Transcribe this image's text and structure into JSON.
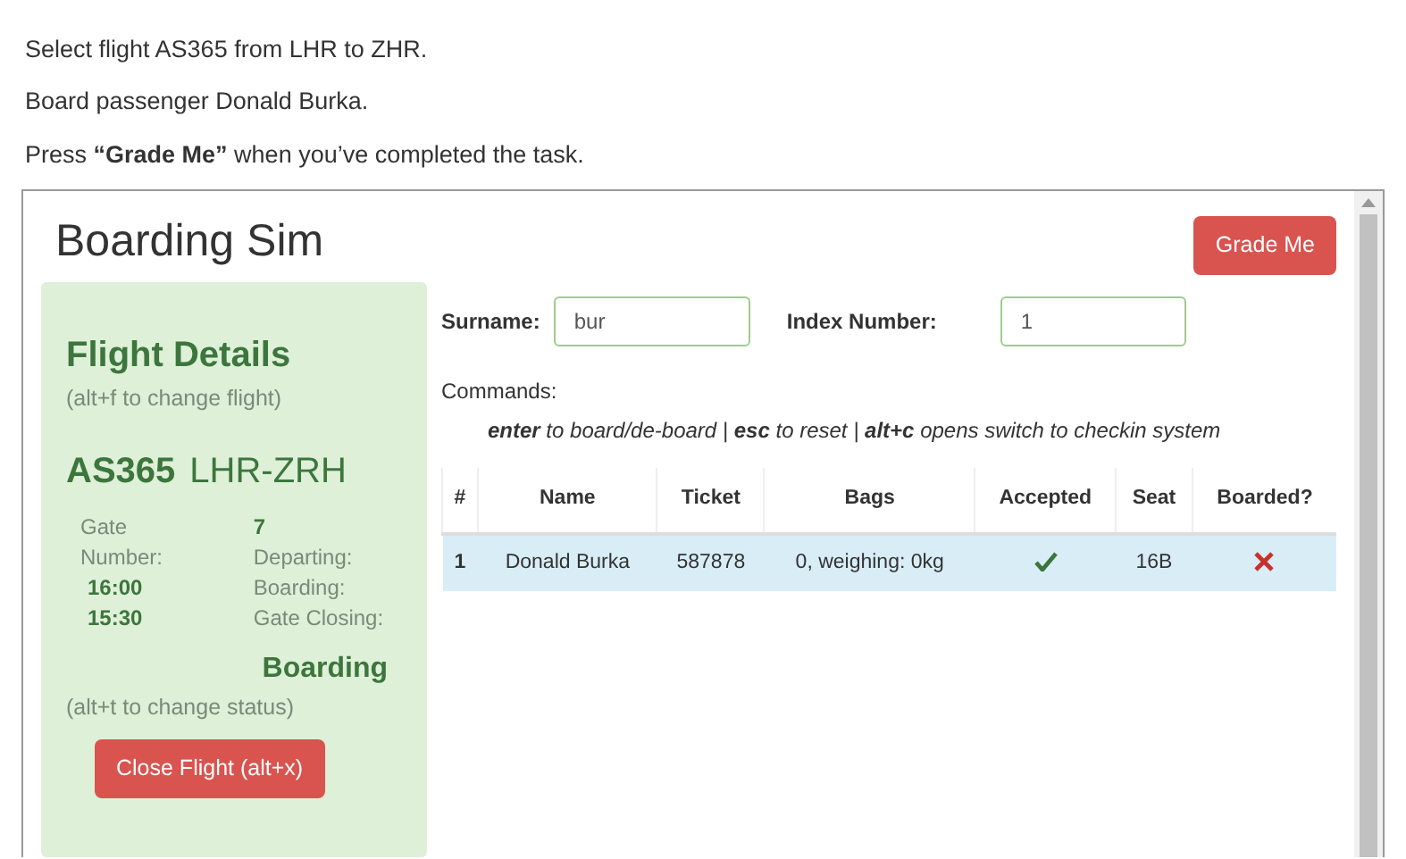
{
  "instructions": [
    "Select flight AS365 from LHR to ZHR.",
    "Board passenger Donald Burka.",
    "Press **“Grade Me”** when you’ve completed the task."
  ],
  "app": {
    "title": "Boarding Sim",
    "grade_button": "Grade Me"
  },
  "flight": {
    "heading": "Flight Details",
    "hint": "(alt+f to change flight)",
    "code": "AS365",
    "route": "LHR-ZRH",
    "left": [
      {
        "text": "Gate Number:",
        "kind": "label"
      },
      {
        "text": "16:00",
        "kind": "value"
      },
      {
        "text": "15:30",
        "kind": "value"
      }
    ],
    "right": [
      {
        "text": "7",
        "kind": "value"
      },
      {
        "text": "Departing:",
        "kind": "label"
      },
      {
        "text": "Boarding:",
        "kind": "label"
      },
      {
        "text": "Gate Closing:",
        "kind": "label"
      }
    ],
    "status": "Boarding",
    "status_hint": "(alt+t to change status)",
    "close_button": "Close Flight (alt+x)"
  },
  "search": {
    "surname_label": "Surname:",
    "surname": "bur",
    "index_label": "Index Number:",
    "index": "1"
  },
  "commands": {
    "label": "Commands:",
    "text": "**enter** to board/de-board | **esc** to reset | **alt+c** opens switch to checkin system"
  },
  "table": {
    "columns": [
      "#",
      "Name",
      "Ticket",
      "Bags",
      "Accepted",
      "Seat",
      "Boarded?"
    ],
    "rows": [
      {
        "number": "1",
        "name": "Donald Burka",
        "ticket": "587878",
        "bags": "0, weighing: 0kg",
        "accepted": true,
        "seat": "16B",
        "boarded": false,
        "selected": true
      }
    ]
  }
}
